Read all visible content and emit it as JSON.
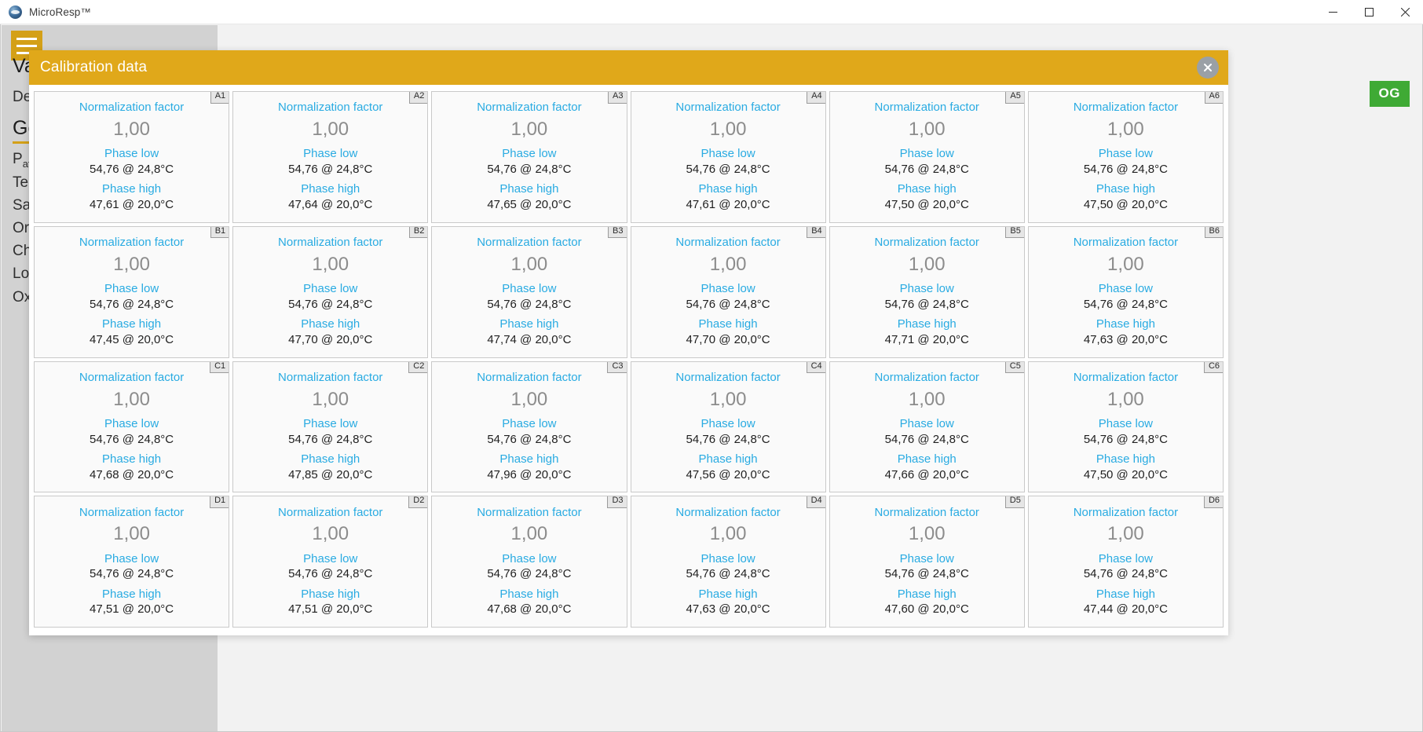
{
  "titlebar": {
    "app_title": "MicroResp™",
    "logo_icon": "microresp-logo-icon",
    "minimize_icon": "minimize-icon",
    "maximize_icon": "maximize-icon",
    "close_icon": "close-icon"
  },
  "sidebar": {
    "hamburger_icon": "hamburger-menu-icon",
    "group_label": "Valu",
    "device_label": "Dev",
    "section_label": "Gen",
    "items": [
      {
        "label": "P",
        "sub": "atm"
      },
      {
        "label": "Tem",
        "sub": ""
      },
      {
        "label": "Salin",
        "sub": ""
      },
      {
        "label": "Org",
        "sub": ""
      },
      {
        "label": "Cha",
        "sub": ""
      },
      {
        "label": "Low",
        "sub": ""
      },
      {
        "label": "Oxy",
        "sub": ""
      }
    ]
  },
  "status_chip": {
    "label": "OG",
    "color": "#3faa35"
  },
  "modal": {
    "title": "Calibration data",
    "header_color": "#e0a81a",
    "close_icon": "close-circle-icon",
    "labels": {
      "normalization_factor": "Normalization factor",
      "phase_low": "Phase low",
      "phase_high": "Phase high"
    }
  },
  "cells": [
    {
      "id": "A1",
      "norm": "1,00",
      "phase_low": "54,76 @ 24,8°C",
      "phase_high": "47,61 @ 20,0°C"
    },
    {
      "id": "A2",
      "norm": "1,00",
      "phase_low": "54,76 @ 24,8°C",
      "phase_high": "47,64 @ 20,0°C"
    },
    {
      "id": "A3",
      "norm": "1,00",
      "phase_low": "54,76 @ 24,8°C",
      "phase_high": "47,65 @ 20,0°C"
    },
    {
      "id": "A4",
      "norm": "1,00",
      "phase_low": "54,76 @ 24,8°C",
      "phase_high": "47,61 @ 20,0°C"
    },
    {
      "id": "A5",
      "norm": "1,00",
      "phase_low": "54,76 @ 24,8°C",
      "phase_high": "47,50 @ 20,0°C"
    },
    {
      "id": "A6",
      "norm": "1,00",
      "phase_low": "54,76 @ 24,8°C",
      "phase_high": "47,50 @ 20,0°C"
    },
    {
      "id": "B1",
      "norm": "1,00",
      "phase_low": "54,76 @ 24,8°C",
      "phase_high": "47,45 @ 20,0°C"
    },
    {
      "id": "B2",
      "norm": "1,00",
      "phase_low": "54,76 @ 24,8°C",
      "phase_high": "47,70 @ 20,0°C"
    },
    {
      "id": "B3",
      "norm": "1,00",
      "phase_low": "54,76 @ 24,8°C",
      "phase_high": "47,74 @ 20,0°C"
    },
    {
      "id": "B4",
      "norm": "1,00",
      "phase_low": "54,76 @ 24,8°C",
      "phase_high": "47,70 @ 20,0°C"
    },
    {
      "id": "B5",
      "norm": "1,00",
      "phase_low": "54,76 @ 24,8°C",
      "phase_high": "47,71 @ 20,0°C"
    },
    {
      "id": "B6",
      "norm": "1,00",
      "phase_low": "54,76 @ 24,8°C",
      "phase_high": "47,63 @ 20,0°C"
    },
    {
      "id": "C1",
      "norm": "1,00",
      "phase_low": "54,76 @ 24,8°C",
      "phase_high": "47,68 @ 20,0°C"
    },
    {
      "id": "C2",
      "norm": "1,00",
      "phase_low": "54,76 @ 24,8°C",
      "phase_high": "47,85 @ 20,0°C"
    },
    {
      "id": "C3",
      "norm": "1,00",
      "phase_low": "54,76 @ 24,8°C",
      "phase_high": "47,96 @ 20,0°C"
    },
    {
      "id": "C4",
      "norm": "1,00",
      "phase_low": "54,76 @ 24,8°C",
      "phase_high": "47,56 @ 20,0°C"
    },
    {
      "id": "C5",
      "norm": "1,00",
      "phase_low": "54,76 @ 24,8°C",
      "phase_high": "47,66 @ 20,0°C"
    },
    {
      "id": "C6",
      "norm": "1,00",
      "phase_low": "54,76 @ 24,8°C",
      "phase_high": "47,50 @ 20,0°C"
    },
    {
      "id": "D1",
      "norm": "1,00",
      "phase_low": "54,76 @ 24,8°C",
      "phase_high": "47,51 @ 20,0°C"
    },
    {
      "id": "D2",
      "norm": "1,00",
      "phase_low": "54,76 @ 24,8°C",
      "phase_high": "47,51 @ 20,0°C"
    },
    {
      "id": "D3",
      "norm": "1,00",
      "phase_low": "54,76 @ 24,8°C",
      "phase_high": "47,68 @ 20,0°C"
    },
    {
      "id": "D4",
      "norm": "1,00",
      "phase_low": "54,76 @ 24,8°C",
      "phase_high": "47,63 @ 20,0°C"
    },
    {
      "id": "D5",
      "norm": "1,00",
      "phase_low": "54,76 @ 24,8°C",
      "phase_high": "47,60 @ 20,0°C"
    },
    {
      "id": "D6",
      "norm": "1,00",
      "phase_low": "54,76 @ 24,8°C",
      "phase_high": "47,44 @ 20,0°C"
    }
  ]
}
